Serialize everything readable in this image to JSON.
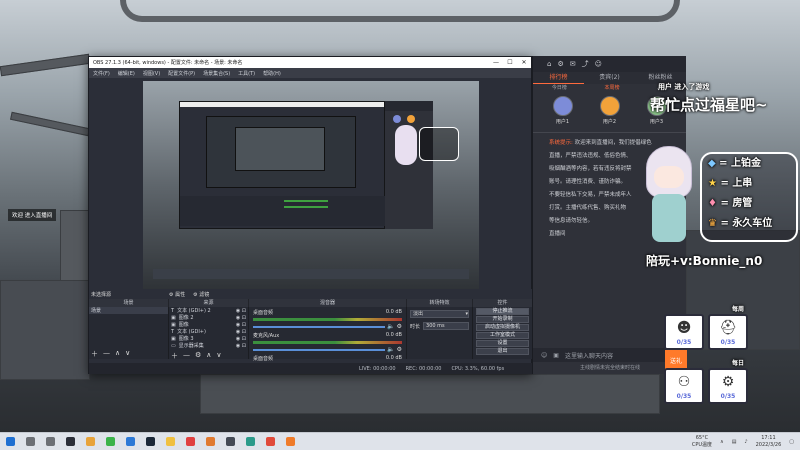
{
  "obs": {
    "title": "OBS 27.1.3 (64-bit, windows) - 配置文件: 未命名 - 场景: 未命名",
    "window_controls": [
      "—",
      "☐",
      "✕"
    ],
    "menu": [
      "文件(F)",
      "编辑(E)",
      "视图(V)",
      "配置文件(P)",
      "场景集合(S)",
      "工具(T)",
      "帮助(H)"
    ],
    "source_bar_label": "未选择源",
    "source_bar_tabs": [
      "属性",
      "滤镜"
    ],
    "dock_titles": [
      "场景",
      "来源",
      "混音器",
      "转场特效",
      "控件"
    ],
    "scenes": [
      "场景"
    ],
    "sources": [
      "文本 (GDI+) 2",
      "图像 2",
      "图像",
      "文本 (GDI+)",
      "图像 3",
      "显示器采集"
    ],
    "mixer": [
      {
        "name": "桌面音频",
        "level": "0.0 dB"
      },
      {
        "name": "麦克风/Aux",
        "level": "0.0 dB"
      },
      {
        "name": "桌面音频",
        "level": "0.0 dB"
      }
    ],
    "transition": {
      "type": "淡出",
      "duration_label": "时长",
      "duration_value": "300 ms"
    },
    "controls": [
      "停止推流",
      "开始录制",
      "启动虚拟摄像机",
      "工作室模式",
      "设置",
      "退出"
    ],
    "status": {
      "live": "LIVE: 00:00:00",
      "rec": "REC: 00:00:00",
      "cpu": "CPU: 3.3%, 60.00 fps"
    }
  },
  "chat": {
    "tabs": [
      "排行榜",
      "贵宾(2)",
      "粉丝粉丝"
    ],
    "subtabs": [
      "今日榜",
      "本周榜",
      "总榜"
    ],
    "top_users": [
      {
        "name": "用户1",
        "color": "#7d8cd8"
      },
      {
        "name": "用户2",
        "color": "#f2a23a"
      },
      {
        "name": "用户3",
        "color": "#8bc48a"
      }
    ],
    "notice_tag": "系统提示:",
    "notice_lines": [
      "欢迎来到直播间，我们提倡绿色",
      "直播，严禁违法违规、低俗色情、",
      "吸烟酗酒等内容，若有违反将封禁",
      "账号。请理性消费、谨防诈骗。",
      "不要轻信私下交易，严禁未成年人",
      "打赏。主播代练代售、购买礼物",
      "等信息请勿轻信。"
    ],
    "room_label": "直播间",
    "input_placeholder": "这里输入聊天内容",
    "gift_button": "送礼",
    "bottom_note": "主线剧情未完全结束时在线"
  },
  "overlay": {
    "join_notice": "用户 进入了游戏",
    "help_text": "帮忙点过福星吧~",
    "ranks": [
      {
        "icon": "gem-icon",
        "label": "上铂金"
      },
      {
        "icon": "star-icon",
        "label": "上串"
      },
      {
        "icon": "shield-icon",
        "label": "房管"
      },
      {
        "icon": "crown-icon",
        "label": "永久车位"
      }
    ],
    "contact": "陪玩+v:Bonnie_n0",
    "card_sections": [
      "每周",
      "每日"
    ],
    "cards": [
      {
        "icon": "character-icon",
        "value": "0/35"
      },
      {
        "icon": "helmet-icon",
        "value": "0/35"
      },
      {
        "icon": "robot-icon",
        "value": "0/35"
      },
      {
        "icon": "gear-icon",
        "value": "0/35"
      }
    ]
  },
  "desktop_chat_label": "欢迎 进入直播间",
  "taskbar": {
    "apps": [
      {
        "name": "start-button",
        "color": "#1f6fd1"
      },
      {
        "name": "search-app",
        "color": "#6c6f75"
      },
      {
        "name": "task-view-app",
        "color": "#6c6f75"
      },
      {
        "name": "obs-app",
        "color": "#2b2e38"
      },
      {
        "name": "files-app",
        "color": "#e8a33a"
      },
      {
        "name": "wechat-app",
        "color": "#3bb34a"
      },
      {
        "name": "browser-app",
        "color": "#2d79d6"
      },
      {
        "name": "steam-app",
        "color": "#1b2838"
      },
      {
        "name": "store-app",
        "color": "#f0c040"
      },
      {
        "name": "music-app",
        "color": "#e04040"
      },
      {
        "name": "photos-app",
        "color": "#e07a30"
      },
      {
        "name": "game-app",
        "color": "#444a55"
      },
      {
        "name": "shield-app",
        "color": "#2b9a8a"
      },
      {
        "name": "stream-app",
        "color": "#e04a3a"
      },
      {
        "name": "video-app",
        "color": "#ef7b2a"
      }
    ],
    "weather": "65°C",
    "weather_sub": "CPU温度",
    "time": "17:11",
    "date": "2022/3/26"
  }
}
